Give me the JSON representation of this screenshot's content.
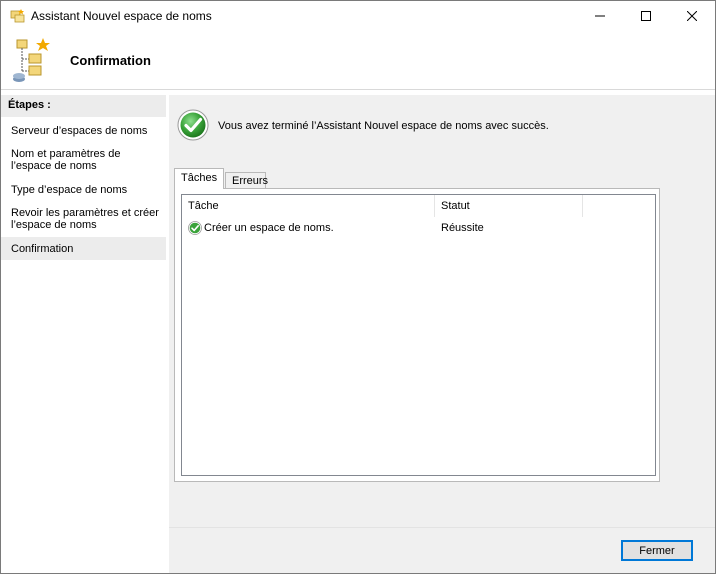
{
  "window": {
    "title": "Assistant Nouvel espace de noms"
  },
  "header": {
    "title": "Confirmation"
  },
  "steps": {
    "heading": "Étapes :",
    "items": [
      {
        "label": "Serveur d’espaces de noms",
        "active": false
      },
      {
        "label": "Nom et paramètres de l’espace de noms",
        "active": false
      },
      {
        "label": "Type d’espace de noms",
        "active": false
      },
      {
        "label": "Revoir les paramètres et créer l’espace de noms",
        "active": false
      },
      {
        "label": "Confirmation",
        "active": true
      }
    ]
  },
  "main": {
    "message": "Vous avez terminé l’Assistant Nouvel espace de noms avec succès.",
    "tabs": [
      {
        "label": "Tâches",
        "active": true
      },
      {
        "label": "Erreurs",
        "active": false
      }
    ],
    "columns": [
      "Tâche",
      "Statut",
      ""
    ],
    "rows": [
      {
        "task": "Créer un espace de noms.",
        "status": "Réussite",
        "icon": "success-check-icon"
      }
    ]
  },
  "buttons": {
    "close": "Fermer"
  },
  "colors": {
    "accent": "#0078d7",
    "success": "#3aa33a",
    "panel_bg": "#f0f0f0",
    "active_step_bg": "#ececec"
  }
}
